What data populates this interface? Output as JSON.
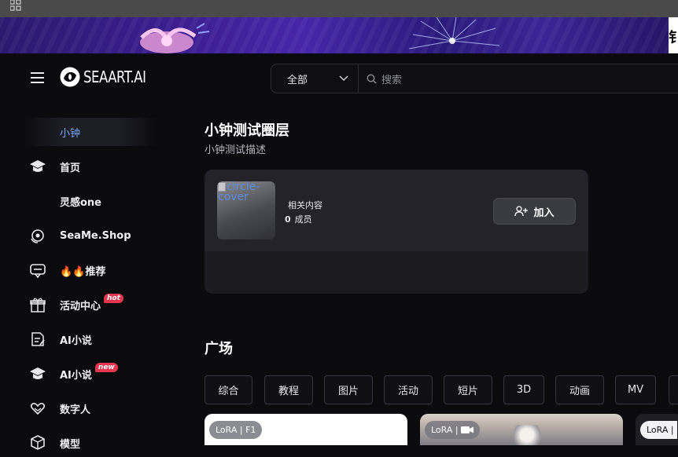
{
  "logo": {
    "text": "SEAART.AI"
  },
  "search": {
    "scope": "全部",
    "placeholder": "搜索"
  },
  "banner": {
    "edge_glyph": "钅"
  },
  "sidebar": {
    "items": [
      {
        "label": "小钟",
        "icon": "none",
        "active": true
      },
      {
        "label": "首页",
        "icon": "graduation-cap-icon"
      },
      {
        "label": "灵感one",
        "icon": "none"
      },
      {
        "label": "SeaMe.Shop",
        "icon": "headset-icon"
      },
      {
        "label": "🔥🔥推荐",
        "icon": "chat-bubble-icon"
      },
      {
        "label": "活动中心",
        "icon": "gift-icon",
        "badge": "hot"
      },
      {
        "label": "AI小说",
        "icon": "document-edit-icon"
      },
      {
        "label": "AI小说",
        "icon": "graduation-cap-icon",
        "badge": "new"
      },
      {
        "label": "数字人",
        "icon": "heart-hands-icon"
      },
      {
        "label": "模型",
        "icon": "cube-icon"
      }
    ]
  },
  "circle": {
    "title": "小钟测试圈层",
    "description": "小钟测试描述",
    "cover_alt": "circle-cover",
    "related_label": "相关内容",
    "member_count": "0",
    "member_label": "成员",
    "join_label": "加入"
  },
  "plaza": {
    "title": "广场",
    "tabs": [
      "综合",
      "教程",
      "图片",
      "活动",
      "短片",
      "3D",
      "动画",
      "MV"
    ]
  },
  "posts": [
    {
      "tag": "LoRA | F1"
    },
    {
      "tag": "LoRA |"
    },
    {
      "tag": "LoRA |"
    }
  ],
  "colors": {
    "accent_blue": "#7aa7ff",
    "badge_red": "#e5364f",
    "card_bg": "#232329"
  }
}
